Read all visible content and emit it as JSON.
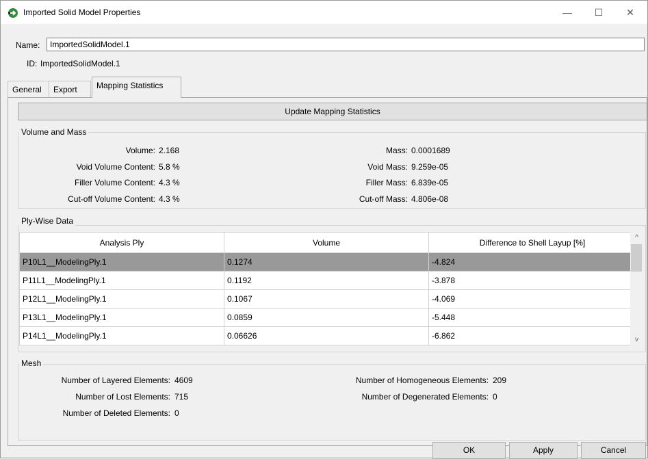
{
  "window": {
    "title": "Imported Solid Model Properties",
    "controls": {
      "minimize": "—",
      "maximize": "☐",
      "close": "✕"
    }
  },
  "name_field": {
    "label": "Name:",
    "value": "ImportedSolidModel.1"
  },
  "id_field": {
    "label": "ID:",
    "value": "ImportedSolidModel.1"
  },
  "tabs": [
    {
      "label": "General",
      "active": false
    },
    {
      "label": "Export",
      "active": false
    },
    {
      "label": "Mapping Statistics",
      "active": true
    }
  ],
  "update_button": "Update Mapping Statistics",
  "volume_mass": {
    "title": "Volume and Mass",
    "left": [
      {
        "label": "Volume:",
        "value": "2.168"
      },
      {
        "label": "Void Volume Content:",
        "value": "5.8 %"
      },
      {
        "label": "Filler Volume Content:",
        "value": "4.3 %"
      },
      {
        "label": "Cut-off Volume Content:",
        "value": "4.3 %"
      }
    ],
    "right": [
      {
        "label": "Mass:",
        "value": "0.0001689"
      },
      {
        "label": "Void Mass:",
        "value": "9.259e-05"
      },
      {
        "label": "Filler Mass:",
        "value": "6.839e-05"
      },
      {
        "label": "Cut-off Mass:",
        "value": "4.806e-08"
      }
    ]
  },
  "ply_wise": {
    "title": "Ply-Wise Data",
    "columns": [
      "Analysis Ply",
      "Volume",
      "Difference  to Shell Layup [%]"
    ],
    "rows": [
      {
        "ply": "P10L1__ModelingPly.1",
        "volume": "0.1274",
        "diff": "-4.824",
        "selected": true
      },
      {
        "ply": "P11L1__ModelingPly.1",
        "volume": "0.1192",
        "diff": "-3.878",
        "selected": false
      },
      {
        "ply": "P12L1__ModelingPly.1",
        "volume": "0.1067",
        "diff": "-4.069",
        "selected": false
      },
      {
        "ply": "P13L1__ModelingPly.1",
        "volume": "0.0859",
        "diff": "-5.448",
        "selected": false
      },
      {
        "ply": "P14L1__ModelingPly.1",
        "volume": "0.06626",
        "diff": "-6.862",
        "selected": false
      }
    ],
    "scroll_up": "^",
    "scroll_down": "v"
  },
  "mesh": {
    "title": "Mesh",
    "left": [
      {
        "label": "Number of Layered Elements:",
        "value": "4609"
      },
      {
        "label": "Number of Lost Elements:",
        "value": "715"
      },
      {
        "label": "Number of Deleted Elements:",
        "value": "0"
      }
    ],
    "right": [
      {
        "label": "Number of Homogeneous Elements:",
        "value": "209"
      },
      {
        "label": "Number of Degenerated Elements:",
        "value": "0"
      }
    ]
  },
  "footer": {
    "ok": "OK",
    "apply": "Apply",
    "cancel": "Cancel"
  },
  "colors": {
    "selected_row": "#999999",
    "window_bg": "#f0f0f0",
    "icon_green": "#2e8b3a"
  }
}
